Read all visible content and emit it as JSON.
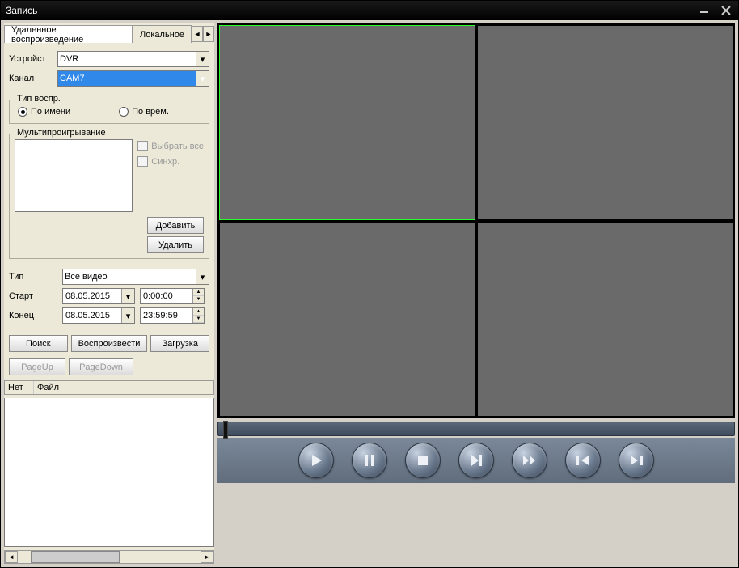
{
  "window": {
    "title": "Запись"
  },
  "tabs": {
    "remote": "Удаленное воспроизведение",
    "local": "Локальное"
  },
  "device": {
    "label": "Устройст",
    "value": "DVR"
  },
  "channel": {
    "label": "Канал",
    "value": "CAM7"
  },
  "playback_type": {
    "title": "Тип воспр.",
    "by_name": "По имени",
    "by_time": "По врем.",
    "selected": "by_name"
  },
  "multiplay": {
    "title": "Мультипроигрывание",
    "select_all": "Выбрать все",
    "sync": "Синхр.",
    "add": "Добавить",
    "delete": "Удалить"
  },
  "type": {
    "label": "Тип",
    "value": "Все видео"
  },
  "start": {
    "label": "Старт",
    "date": "08.05.2015",
    "time": "0:00:00"
  },
  "end": {
    "label": "Конец",
    "date": "08.05.2015",
    "time": "23:59:59"
  },
  "buttons": {
    "search": "Поиск",
    "play": "Воспроизвести",
    "download": "Загрузка",
    "pageup": "PageUp",
    "pagedown": "PageDown"
  },
  "table": {
    "col_no": "Нет",
    "col_file": "Файл"
  }
}
